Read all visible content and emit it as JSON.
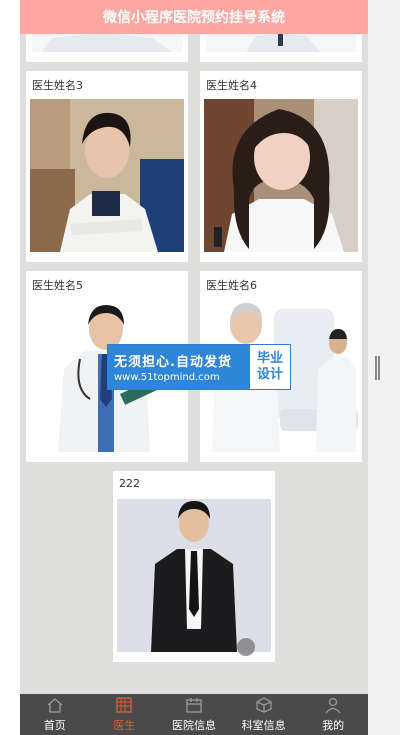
{
  "header": {
    "title": "微信小程序医院预约挂号系统"
  },
  "doctors": [
    {
      "name": "医生姓名3"
    },
    {
      "name": "医生姓名4"
    },
    {
      "name": "医生姓名5"
    },
    {
      "name": "医生姓名6"
    },
    {
      "name": "222"
    }
  ],
  "watermark": {
    "line1": "无须担心.自动发货",
    "line2": "www.51topmind.com",
    "right1": "毕业",
    "right2": "设计"
  },
  "tabbar": {
    "items": [
      {
        "label": "首页",
        "icon": "home-icon",
        "active": false
      },
      {
        "label": "医生",
        "icon": "doctor-icon",
        "active": true
      },
      {
        "label": "医院信息",
        "icon": "calendar-icon",
        "active": false
      },
      {
        "label": "科室信息",
        "icon": "cube-icon",
        "active": false
      },
      {
        "label": "我的",
        "icon": "user-icon",
        "active": false
      }
    ]
  },
  "colors": {
    "header_bg": "#fca7a2",
    "active_tab": "#e05a3a",
    "tabbar_bg": "#4a4a4a"
  }
}
